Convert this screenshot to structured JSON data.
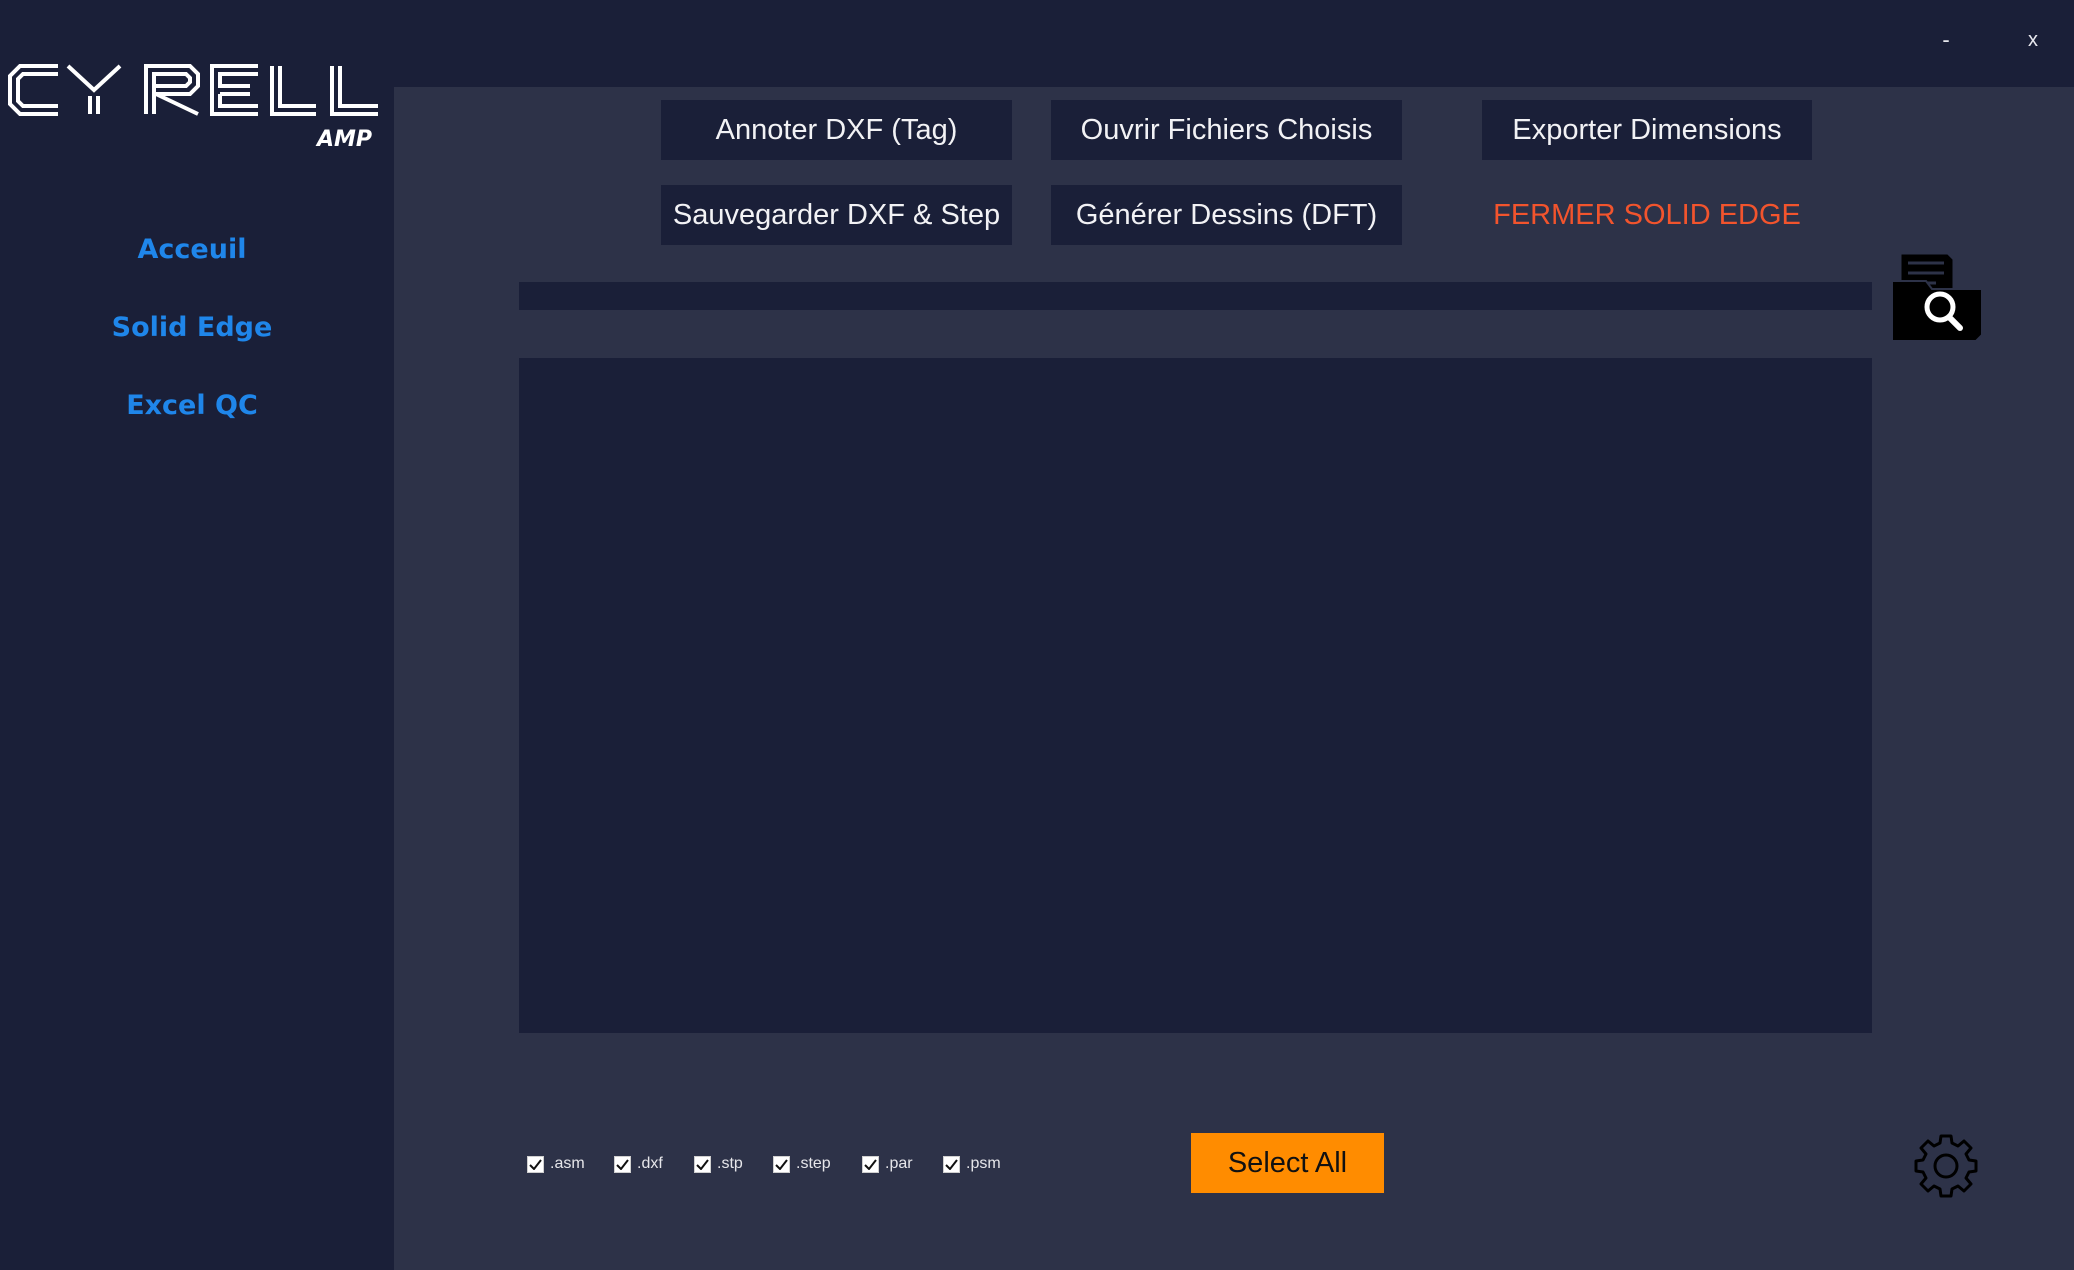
{
  "window": {
    "minimize_label": "-",
    "close_label": "x"
  },
  "logo": {
    "brand": "CYRELL",
    "sub": "AMP"
  },
  "sidebar": {
    "items": [
      {
        "label": "Acceuil"
      },
      {
        "label": "Solid Edge"
      },
      {
        "label": "Excel QC"
      }
    ]
  },
  "toolbar": {
    "annotate_label": "Annoter DXF (Tag)",
    "open_files_label": "Ouvrir Fichiers Choisis",
    "export_dimensions_label": "Exporter Dimensions",
    "save_dxf_step_label": "Sauvegarder DXF & Step",
    "generate_drawings_label": "Générer Dessins (DFT)",
    "close_solid_edge_label": "FERMER SOLID EDGE"
  },
  "progress": {
    "value": 0
  },
  "filters": [
    {
      "label": ".asm",
      "checked": true
    },
    {
      "label": ".dxf",
      "checked": true
    },
    {
      "label": ".stp",
      "checked": true
    },
    {
      "label": ".step",
      "checked": true
    },
    {
      "label": ".par",
      "checked": true
    },
    {
      "label": ".psm",
      "checked": true
    }
  ],
  "select_all_label": "Select All",
  "icons": {
    "browse": "folder-search-icon",
    "settings": "gear-icon"
  },
  "colors": {
    "background": "#1a1f38",
    "panel": "#2d3248",
    "accent": "#1f86ea",
    "danger": "#f2542d",
    "primary_button": "#ff8c00"
  }
}
